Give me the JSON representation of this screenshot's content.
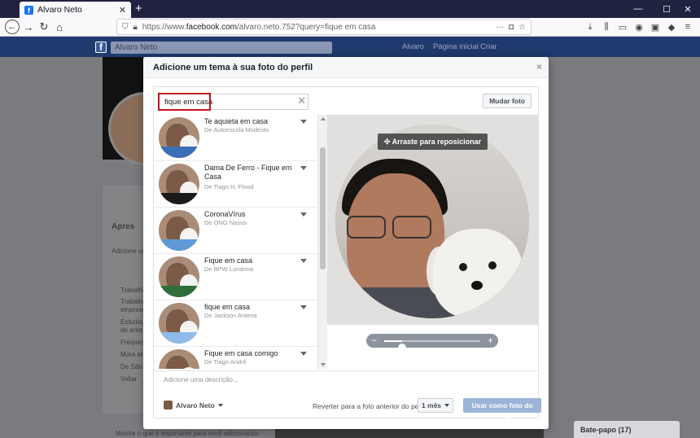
{
  "browser": {
    "tab_title": "Alvaro Neto",
    "tab_favicon": "f",
    "new_tab": "+",
    "url_domain_prefix": "https://www.",
    "url_domain": "facebook.com",
    "url_path": "/alvaro.neto.752?query=fique em casa",
    "overflow_menu": "···",
    "window_controls": [
      "—",
      "☐",
      "✕"
    ]
  },
  "facebook": {
    "logo": "f",
    "search_value": "Alvaro Neto",
    "nav": [
      "Alvaro",
      "Página inicial",
      "Criar"
    ]
  },
  "background": {
    "profile_items": [
      "Trabalha",
      "Trabalha",
      "emprese",
      "Estudou",
      "de ante",
      "Frequen",
      "Mora em",
      "De São",
      "Voltar"
    ],
    "section_title": "Apres",
    "section_text": "Adicione um",
    "footer_text": "Mostre o que é importante para você adicionando",
    "chat_label": "Bate-papo",
    "chat_count": "(17)"
  },
  "modal": {
    "title": "Adicione um tema à sua foto do perfil",
    "close": "×",
    "search": {
      "value": "fique em casa",
      "placeholder": ""
    },
    "clear": "✕",
    "change_photo": "Mudar foto",
    "frames": [
      {
        "title": "Te aquieta em casa",
        "author": "De Autoescola Modesto",
        "band_color": "#3b6fb6"
      },
      {
        "title": "Dama De Ferro - Fique em Casa",
        "author": "De Tiago H. Flood",
        "band_color": "#1a1a1a"
      },
      {
        "title": "CoronaVírus",
        "author": "De ONG Nasus",
        "band_color": "#5f9ad6"
      },
      {
        "title": "Fique em casa",
        "author": "De BPW Londrina",
        "band_color": "#2f6e3a"
      },
      {
        "title": "fique em casa",
        "author": "De Jackson Antena",
        "band_color": "#8ebbe8"
      },
      {
        "title": "Fique em casa comigo",
        "author": "De Tiago André",
        "band_color": "#c9a66b"
      }
    ],
    "drag_hint": "✣ Arraste para reposicionar",
    "zoom": {
      "minus": "−",
      "plus": "+",
      "level": 0.19
    },
    "description_placeholder": "Adicione uma descrição...",
    "audience": "Alvaro Neto",
    "revert_label": "Reverter para a foto anterior do perfil",
    "period": "1 mês",
    "use_frame": "Usar como foto do perfil"
  },
  "colors": {
    "fb_header": "#1f3a6e",
    "primary_disabled": "#9cb4d8",
    "highlight_box": "#c4121e"
  }
}
